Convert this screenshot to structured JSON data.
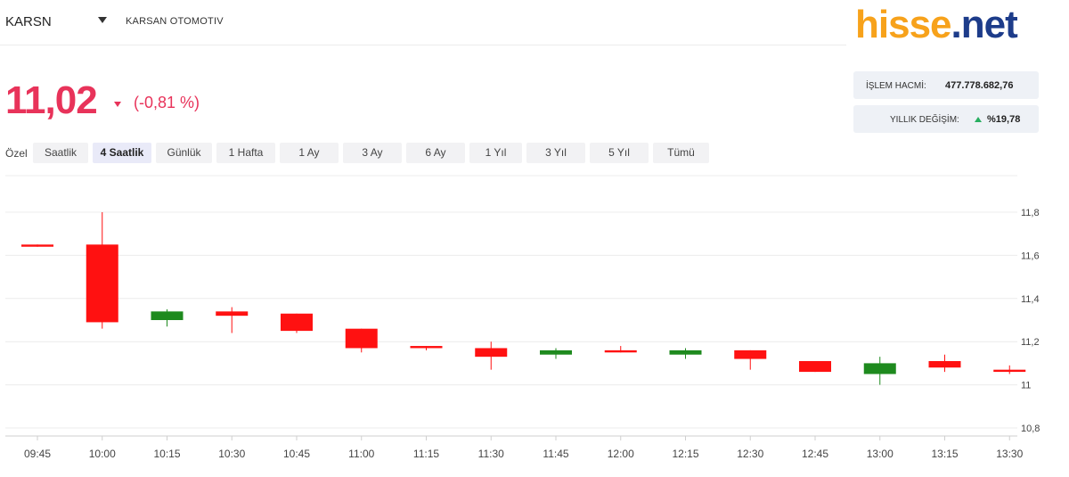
{
  "header": {
    "ticker": "KARSN",
    "company": "KARSAN OTOMOTIV",
    "logo_part1": "hisse",
    "logo_part2": ".net"
  },
  "quote": {
    "price": "11,02",
    "change": "(-0,81 %)",
    "direction": "down",
    "color": "#e8335a"
  },
  "stats": {
    "volume_label": "İŞLEM HACMİ:",
    "volume_value": "477.778.682,76",
    "yearly_label": "YILLIK DEĞİŞİM:",
    "yearly_value": "%19,78",
    "yearly_direction": "up"
  },
  "ranges": {
    "label": "Özel",
    "tabs": [
      "Saatlik",
      "4 Saatlik",
      "Günlük",
      "1 Hafta",
      "1 Ay",
      "3 Ay",
      "6 Ay",
      "1 Yıl",
      "3 Yıl",
      "5 Yıl",
      "Tümü"
    ],
    "active": "4 Saatlik"
  },
  "chart_data": {
    "type": "candlestick",
    "ylim": [
      10.8,
      11.8
    ],
    "y_ticks": [
      "11,8",
      "11,6",
      "11,4",
      "11,2",
      "11",
      "10,8"
    ],
    "y_tick_values": [
      11.8,
      11.6,
      11.4,
      11.2,
      11.0,
      10.8
    ],
    "grid": true,
    "up_color": "#1e8a1e",
    "down_color": "#ff1111",
    "categories": [
      "09:45",
      "10:00",
      "10:15",
      "10:30",
      "10:45",
      "11:00",
      "11:15",
      "11:30",
      "11:45",
      "12:00",
      "12:15",
      "12:30",
      "12:45",
      "13:00",
      "13:15",
      "13:30"
    ],
    "candles": [
      {
        "open": 11.65,
        "close": 11.64,
        "high": 11.65,
        "low": 11.64
      },
      {
        "open": 11.65,
        "close": 11.29,
        "high": 11.8,
        "low": 11.26
      },
      {
        "open": 11.3,
        "close": 11.34,
        "high": 11.35,
        "low": 11.27
      },
      {
        "open": 11.34,
        "close": 11.32,
        "high": 11.36,
        "low": 11.24
      },
      {
        "open": 11.33,
        "close": 11.25,
        "high": 11.33,
        "low": 11.24
      },
      {
        "open": 11.26,
        "close": 11.17,
        "high": 11.26,
        "low": 11.15
      },
      {
        "open": 11.18,
        "close": 11.17,
        "high": 11.18,
        "low": 11.16
      },
      {
        "open": 11.17,
        "close": 11.13,
        "high": 11.2,
        "low": 11.07
      },
      {
        "open": 11.14,
        "close": 11.16,
        "high": 11.17,
        "low": 11.12
      },
      {
        "open": 11.16,
        "close": 11.15,
        "high": 11.18,
        "low": 11.15
      },
      {
        "open": 11.14,
        "close": 11.16,
        "high": 11.17,
        "low": 11.12
      },
      {
        "open": 11.16,
        "close": 11.12,
        "high": 11.16,
        "low": 11.07
      },
      {
        "open": 11.11,
        "close": 11.06,
        "high": 11.11,
        "low": 11.06
      },
      {
        "open": 11.05,
        "close": 11.1,
        "high": 11.13,
        "low": 11.0
      },
      {
        "open": 11.11,
        "close": 11.08,
        "high": 11.14,
        "low": 11.06
      },
      {
        "open": 11.07,
        "close": 11.06,
        "high": 11.09,
        "low": 11.05
      }
    ]
  }
}
